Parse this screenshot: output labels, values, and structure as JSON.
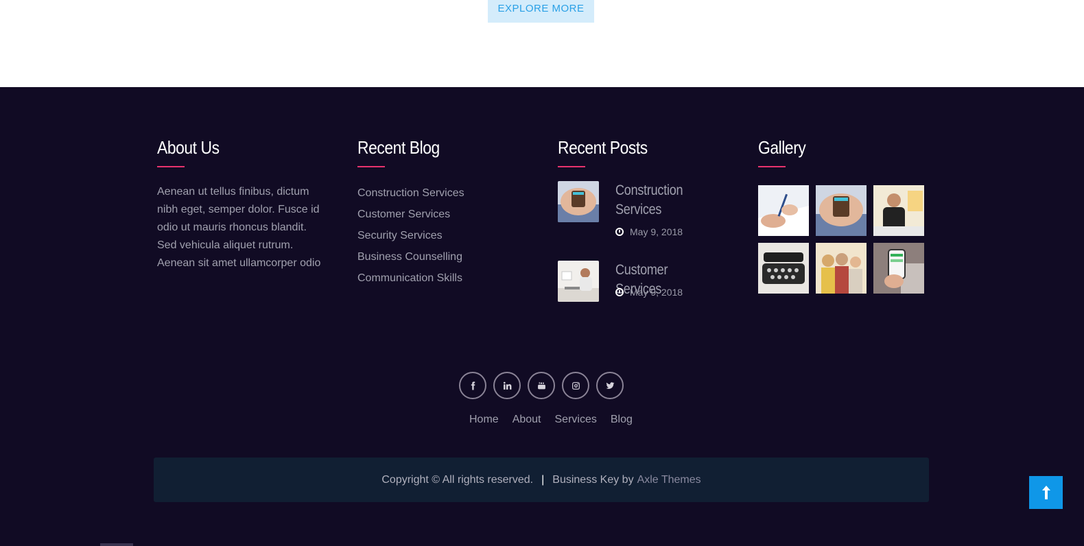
{
  "explore_button": "EXPLORE MORE",
  "about": {
    "title": "About Us",
    "text": "Aenean ut tellus finibus, dictum nibh eget, semper dolor. Fusce id odio ut mauris rhoncus blandit. Sed vehicula aliquet rutrum. Aenean sit amet ullamcorper odio"
  },
  "recent_blog": {
    "title": "Recent Blog",
    "items": [
      "Construction Services",
      "Customer Services",
      "Security Services",
      "Business Counselling",
      "Communication Skills"
    ]
  },
  "recent_posts": {
    "title": "Recent Posts",
    "posts": [
      {
        "title": "Construction Services",
        "date": "May 9, 2018",
        "thumb": "hands-wallet"
      },
      {
        "title": "Customer Services",
        "date": "May 9, 2018",
        "thumb": "man-at-desk"
      }
    ]
  },
  "gallery": {
    "title": "Gallery",
    "images": [
      "signing-document",
      "hands-wallet",
      "man-on-phone",
      "typewriter",
      "women-group",
      "phone-in-hand"
    ]
  },
  "socials": [
    "facebook-icon",
    "linkedin-icon",
    "youtube-icon",
    "instagram-icon",
    "twitter-icon"
  ],
  "footer_nav": [
    "Home",
    "About",
    "Services",
    "Blog"
  ],
  "copyright": {
    "text": "Copyright © All rights reserved.",
    "separator": "|",
    "credit": "Business Key by",
    "link": "Axle Themes"
  },
  "colors": {
    "footer_bg": "#110b24",
    "accent_pink": "#e8336d",
    "scroll_top_blue": "#0f97e8",
    "copyright_bg": "#111f33"
  }
}
